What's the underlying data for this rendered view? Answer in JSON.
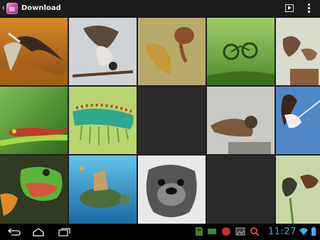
{
  "app": {
    "title": "Download",
    "back_icon": "back-caret-icon",
    "app_icon": "gallery-app-icon",
    "actions": [
      "slideshow-icon",
      "overflow-menu-icon"
    ]
  },
  "gallery": {
    "rows": 3,
    "columns": 5,
    "items": [
      "heron-flying",
      "falcon-on-branch",
      "fish-and-snail",
      "snail-bicycle",
      "bird-feeding-chick",
      "lizard-on-leaf",
      "caterpillar",
      "empty",
      "sparrow-bathing",
      "eagle-diving",
      "frog-mouth-open",
      "turtle-underwater",
      "pug-portrait",
      "empty",
      "bird-on-plant"
    ]
  },
  "navigation": {
    "buttons": [
      "back-icon",
      "home-icon",
      "recent-apps-icon"
    ]
  },
  "status_bar": {
    "time": "11:27",
    "notification_icons": [
      "sd-card-icon",
      "screen-icon",
      "record-icon",
      "picture-icon",
      "search-icon"
    ],
    "system_icons": [
      "wifi-icon",
      "battery-icon"
    ]
  }
}
